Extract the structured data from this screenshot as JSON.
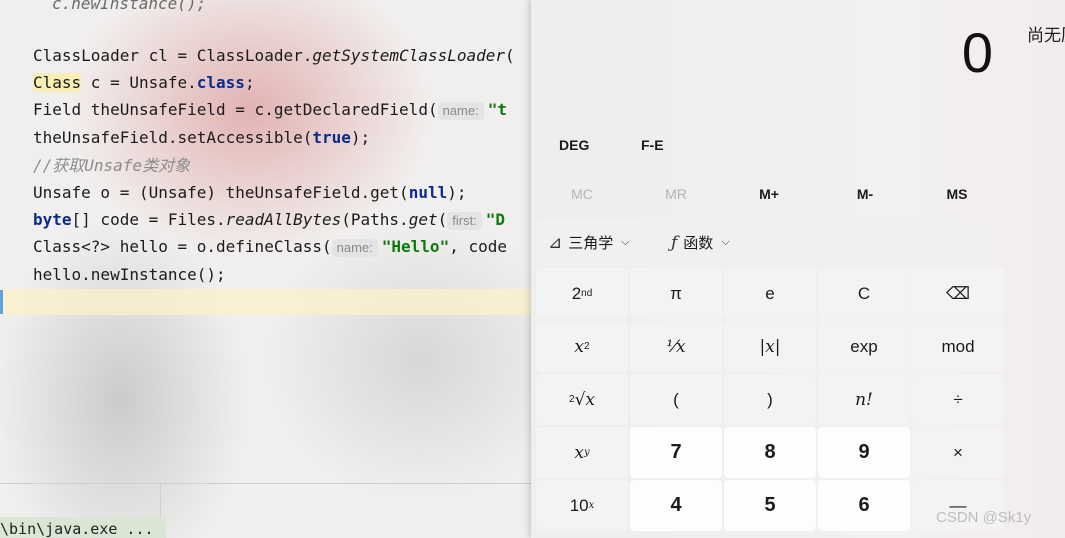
{
  "editor": {
    "lines": {
      "l0": "c.newInstance();",
      "l1_a": "ClassLoader cl = ClassLoader.",
      "l1_b": "getSystemClassLoader",
      "l1_c": "(",
      "l2_a": "Class",
      "l2_b": " c = Unsafe.",
      "l2_c": "class",
      "l2_d": ";",
      "l3_a": "Field theUnsafeField = c.getDeclaredField(",
      "l3_hint": "name:",
      "l3_str": "\"t",
      "l4_a": "theUnsafeField.setAccessible(",
      "l4_b": "true",
      "l4_c": ");",
      "l5": "//获取Unsafe类对象",
      "l6_a": "Unsafe o = (Unsafe) theUnsafeField.get(",
      "l6_b": "null",
      "l6_c": ");",
      "l7_a": "byte",
      "l7_b": "[] code = Files.",
      "l7_c": "readAllBytes",
      "l7_d": "(Paths.",
      "l7_e": "get",
      "l7_f": "(",
      "l7_hint": "first:",
      "l7_str": "\"D",
      "l8_a": "Class<?> hello = o.defineClass(",
      "l8_hint": "name:",
      "l8_str": "\"Hello\"",
      "l8_b": ", code",
      "l9": "hello.newInstance();"
    },
    "run_path": "\\bin\\java.exe ..."
  },
  "calculator": {
    "display": "0",
    "history_label": "尚无历史记录",
    "modes": {
      "deg": "DEG",
      "fe": "F-E"
    },
    "memory": [
      "MC",
      "MR",
      "M+",
      "M-",
      "MS"
    ],
    "trig": {
      "icon": "⊿",
      "label": "三角学",
      "chevron": "⌵"
    },
    "func": {
      "icon": "ƒ",
      "label": "函数",
      "chevron": "⌵"
    },
    "keys": {
      "second": "2",
      "second_sup": "nd",
      "pi": "π",
      "e": "e",
      "clear": "C",
      "backspace": "⌫",
      "x_sq": "x",
      "x_sq_sup": "2",
      "recip": "⅟x",
      "abs": "|x|",
      "exp": "exp",
      "mod": "mod",
      "root_pre": "2",
      "root_sym": "√x",
      "lparen": "(",
      "rparen": ")",
      "fact": "n!",
      "div": "÷",
      "xy": "x",
      "xy_sup": "y",
      "d7": "7",
      "d8": "8",
      "d9": "9",
      "mul": "×",
      "ten_x": "10",
      "ten_x_sup": "x",
      "d4": "4",
      "d5": "5",
      "d6": "6",
      "minus": "—"
    }
  },
  "watermark": "CSDN @Sk1y",
  "colors": {
    "keyword": "#0a2a8c",
    "string": "#0a7a0a",
    "comment": "#8c8c8c",
    "highlight": "#f8edb2"
  }
}
